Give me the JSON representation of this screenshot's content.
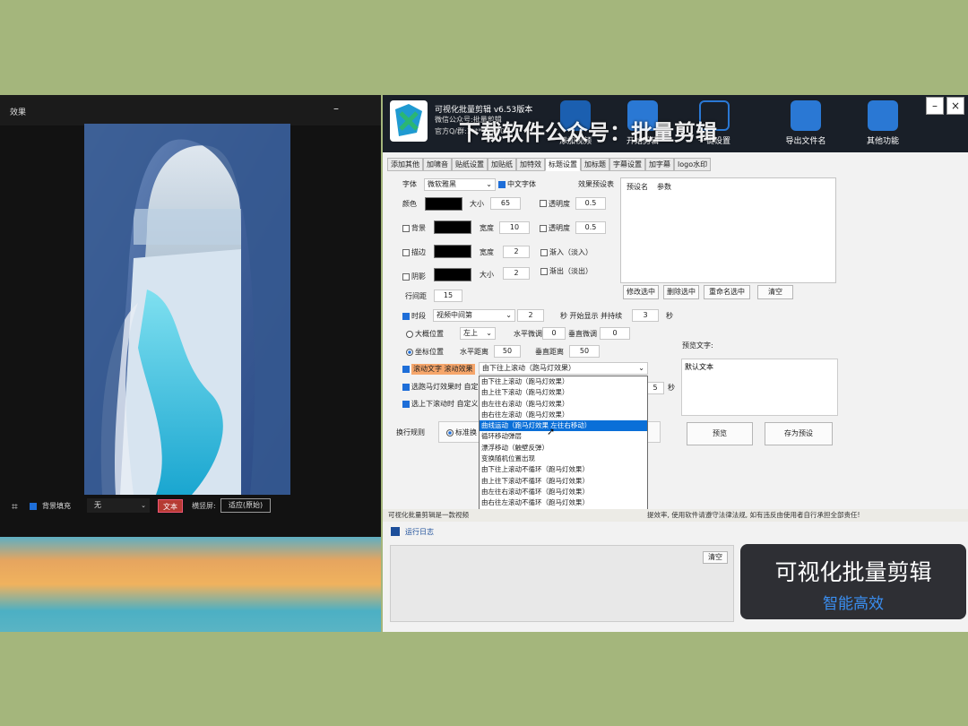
{
  "preview_window": {
    "title": "效果",
    "minimize_label": "–",
    "bg_fill_label": "背景填充",
    "bg_fill_value": "无",
    "text_button": "文本",
    "aspect_label": "横竖屏:",
    "aspect_value": "适应(原始)"
  },
  "app": {
    "title": "可视化批量剪辑 v6.53版本",
    "wechat": "微信公众号:批量剪辑",
    "qq": "官方Q/群:1***36260",
    "watermark": "下载软件公众号：批量剪辑",
    "toolbar": {
      "btn1": "添加视频",
      "btn2": "开始剪辑",
      "btn3": "一键设置",
      "btn4": "导出文件名",
      "btn5": "其他功能"
    },
    "min_label": "–",
    "close_label": "×"
  },
  "tabs": [
    "添加其他",
    "加啸音",
    "贴纸设置",
    "加贴纸",
    "加特效",
    "标题设置",
    "加标题",
    "字幕设置",
    "加字幕",
    "logo水印"
  ],
  "active_tab": 5,
  "form": {
    "font_label": "字体",
    "font_value": "微软雅黑",
    "cn_font_label": "中文字体",
    "preset_table_label": "效果预设表",
    "color_label": "颜色",
    "size_label": "大小",
    "size_value": "65",
    "opacity_label": "透明度",
    "opacity_value": "0.5",
    "bg_label": "背景",
    "width_label": "宽度",
    "bg_width_value": "10",
    "bg_opacity_value": "0.5",
    "stroke_label": "描边",
    "stroke_width_value": "2",
    "fadein_label": "渐入（淡入）",
    "shadow_label": "阴影",
    "shadow_size_value": "2",
    "fadeout_label": "渐出（淡出）",
    "line_spacing_label": "行间距",
    "line_spacing_value": "15",
    "timing_label": "时段",
    "timing_value": "视频中间第",
    "timing_num": "2",
    "timing_text1": "秒 开始显示 并持续",
    "timing_duration": "3",
    "timing_unit": "秒",
    "rough_pos_label": "大概位置",
    "rough_pos_value": "左上",
    "hfine_label": "水平微调",
    "hfine_value": "0",
    "vfine_label": "垂直微调",
    "vfine_value": "0",
    "coord_pos_label": "坐标位置",
    "hdist_label": "水平距离",
    "hdist_value": "50",
    "vdist_label": "垂直距离",
    "vdist_value": "50",
    "scroll_label": "滚动文字 滚动效果",
    "scroll_value": "由下往上滚动（跑马灯效果）",
    "marquee_label": "选跑马灯效果时 自定",
    "updown_label": "选上下滚动时 自定义",
    "extra_num": "5",
    "extra_unit": "秒",
    "wrap_label": "换行规则",
    "wrap_opt": "标准换"
  },
  "preset_table": {
    "headers": [
      "预设名",
      "参数"
    ],
    "buttons": [
      "修改选中",
      "删除选中",
      "重命名选中",
      "清空"
    ]
  },
  "preview_text": {
    "label": "预览文字:",
    "value": "默认文本",
    "preview_btn": "预览",
    "save_btn": "存为预设"
  },
  "dropdown_options": [
    "由下往上滚动（跑马灯效果）",
    "由上往下滚动（跑马灯效果）",
    "由左往右滚动（跑马灯效果）",
    "由右往左滚动（跑马灯效果）",
    "曲线运动（跑马灯效果 左往右移动）",
    "循环移动弹层",
    "漂浮移动（触壁反弹）",
    "变换随机位置出现",
    "由下往上滚动不循环（跑马灯效果）",
    "由上往下滚动不循环（跑马灯效果）",
    "由左往右滚动不循环（跑马灯效果）",
    "由右往左滚动不循环（跑马灯效果）",
    "曲线运动不循环（跑马灯效果 左往右移动）"
  ],
  "dropdown_selected": 4,
  "footer_note_left": "可视化批量剪辑是一款视频",
  "footer_note_right": "提效率, 使用软件请遵守法律法规, 如有违反由使用者自行承担全部责任!",
  "log": {
    "label": "运行日志",
    "clear": "清空"
  },
  "promo": {
    "title": "可视化批量剪辑",
    "subtitle": "智能高效"
  },
  "colors": {
    "accent": "#1e6ed8",
    "banner": "#191f28",
    "background": "#a4b67c"
  }
}
